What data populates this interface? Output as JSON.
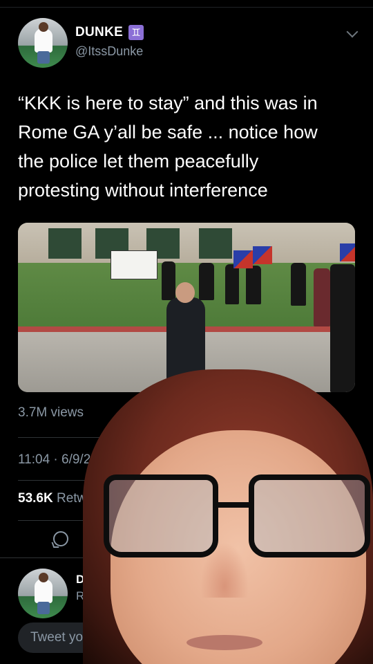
{
  "tweet": {
    "author": {
      "display_name": "DUNKE",
      "badge": "♊",
      "handle": "@ItssDunke"
    },
    "text": "“KKK is here to stay” and this was in\nRome GA y’all be safe ... notice how\nthe police let them peacefully\nprotesting without interference",
    "media": {
      "sign_text": "",
      "description_visible": false
    },
    "views": "3.7M views",
    "timestamp": "11:04 · 6/9/20",
    "retweets": {
      "count": "53.6K",
      "label": "Retwe"
    }
  },
  "reply_preview": {
    "name": "D",
    "sub": "R"
  },
  "compose": {
    "placeholder": "Tweet yo"
  },
  "colors": {
    "background": "#000000",
    "text_primary": "#ffffff",
    "text_secondary": "#8b98a5",
    "badge": "#8b6fd6"
  },
  "icons": {
    "menu": "chevron-down-icon",
    "reply": "reply-icon"
  }
}
